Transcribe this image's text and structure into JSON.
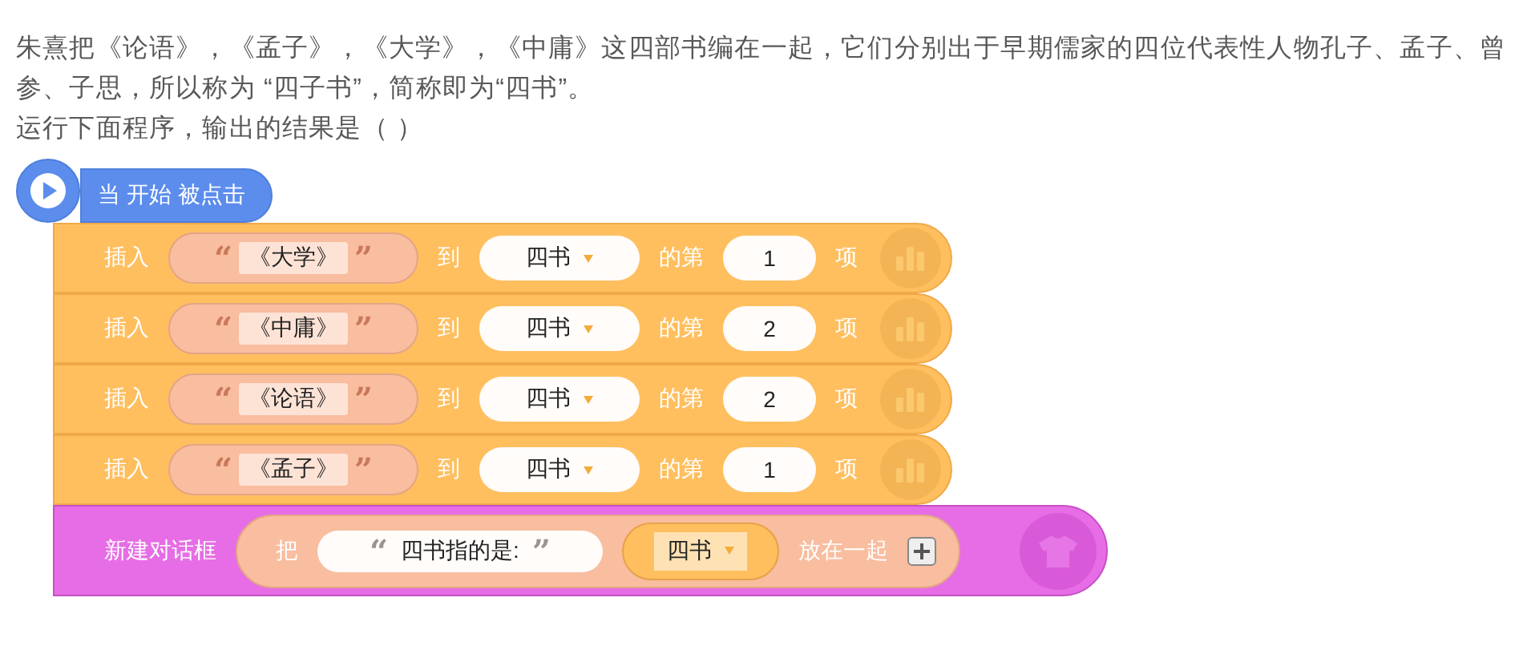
{
  "question": {
    "paragraphs": [
      "朱熹把《论语》，《孟子》，《大学》，《中庸》这四部书编在一起，它们分别出于早期儒家的四位代表性人物孔子、孟子、曾参、子思，所以称为 “四子书”，简称即为“四书”。",
      "运行下面程序，输出的结果是（   ）"
    ]
  },
  "script": {
    "hat": {
      "label": "当 开始 被点击"
    },
    "blocks": [
      {
        "kind": "insert",
        "label": "插入",
        "quote_open": "“",
        "text": "《大学》",
        "quote_close": "”",
        "to": "到",
        "list": "四书",
        "position_label": "的第",
        "index": "1",
        "item": "项"
      },
      {
        "kind": "insert",
        "label": "插入",
        "quote_open": "“",
        "text": "《中庸》",
        "quote_close": "”",
        "to": "到",
        "list": "四书",
        "position_label": "的第",
        "index": "2",
        "item": "项"
      },
      {
        "kind": "insert",
        "label": "插入",
        "quote_open": "“",
        "text": "《论语》",
        "quote_close": "”",
        "to": "到",
        "list": "四书",
        "position_label": "的第",
        "index": "2",
        "item": "项"
      },
      {
        "kind": "insert",
        "label": "插入",
        "quote_open": "“",
        "text": "《孟子》",
        "quote_close": "”",
        "to": "到",
        "list": "四书",
        "position_label": "的第",
        "index": "1",
        "item": "项"
      },
      {
        "kind": "dialog",
        "label": "新建对话框",
        "join_label": "把",
        "quote_open": "“",
        "text": "四书指的是:",
        "quote_close": "”",
        "list": "四书",
        "end_label": "放在一起"
      }
    ]
  }
}
